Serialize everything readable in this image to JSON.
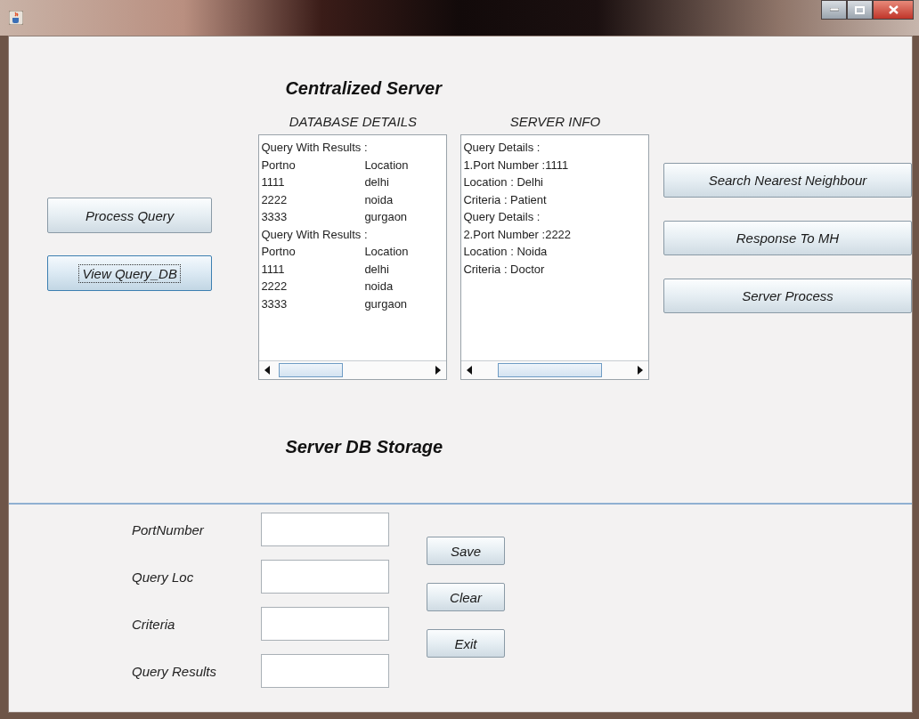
{
  "heading": "Centralized Server",
  "panels": [
    {
      "title": "DATABASE DETAILS",
      "lines": [
        {
          "text": "Query With Results :"
        },
        {
          "text": "Portno",
          "col_2": "Location"
        },
        {
          "text": "1111",
          "col_2": "delhi"
        },
        {
          "text": "2222",
          "col_2": "noida"
        },
        {
          "text": "3333",
          "col_2": "gurgaon"
        },
        {
          "text": "Query With Results :"
        },
        {
          "text": "Portno",
          "col_2": "Location"
        },
        {
          "text": "1111",
          "col_2": "delhi"
        },
        {
          "text": "2222",
          "col_2": "noida"
        },
        {
          "text": "3333",
          "col_2": "gurgaon"
        }
      ]
    },
    {
      "title": "SERVER INFO",
      "lines": [
        {
          "text": "Query Details :"
        },
        {
          "text": "1.Port Number :1111"
        },
        {
          "text": "Location : Delhi"
        },
        {
          "text": "Criteria : Patient"
        },
        {
          "text": "Query Details :"
        },
        {
          "text": "2.Port Number :2222"
        },
        {
          "text": "Location : Noida"
        },
        {
          "text": "Criteria : Doctor"
        }
      ]
    }
  ],
  "left_buttons": [
    {
      "label": "Process Query",
      "focused": false
    },
    {
      "label": "View Query_DB",
      "focused": true
    }
  ],
  "right_buttons": [
    "Search Nearest Neighbour",
    "Response To MH",
    "Server Process"
  ],
  "storage_heading": "Server DB Storage",
  "form": {
    "fields": [
      {
        "label": "PortNumber"
      },
      {
        "label": "Query Loc"
      },
      {
        "label": "Criteria"
      },
      {
        "label": "Query Results"
      }
    ],
    "buttons": [
      "Save",
      "Clear",
      "Exit"
    ]
  }
}
